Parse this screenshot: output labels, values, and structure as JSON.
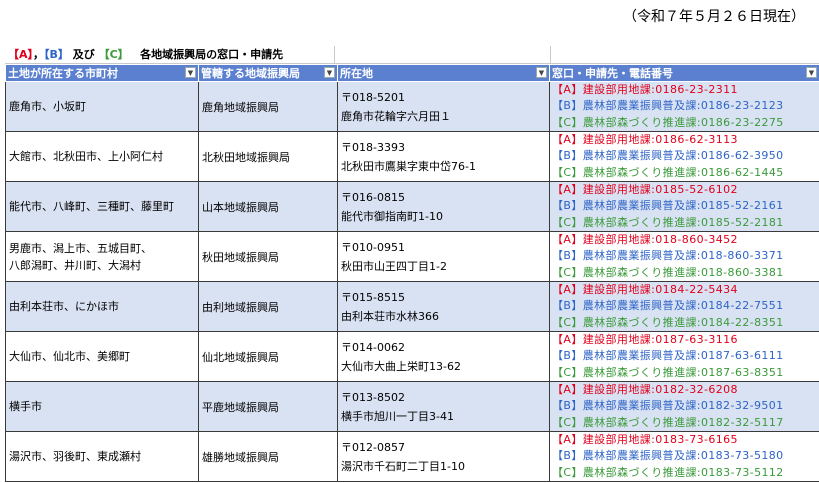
{
  "date_note": "（令和７年５月２６日現在）",
  "legend": {
    "a": "【A】",
    "sep1": "，",
    "b": "【B】",
    "and": " 及び ",
    "c": "【C】",
    "title": "各地域振興局の窓口・申請先"
  },
  "headers": [
    "土地が所在する市町村",
    "管轄する地域振興局",
    "所在地",
    "窓口・申請先・電話番号"
  ],
  "rows": [
    {
      "municipality": [
        "鹿角市、小坂町"
      ],
      "bureau": "鹿角地域振興局",
      "postal": "〒018-5201",
      "address": "鹿角市花輪字六月田１",
      "contacts": [
        "【A】建設部用地課:0186-23-2311",
        "【B】農林部農業振興普及課:0186-23-2123",
        "【C】農林部森づくり推進課:0186-23-2275"
      ]
    },
    {
      "municipality": [
        "大館市、北秋田市、上小阿仁村"
      ],
      "bureau": "北秋田地域振興局",
      "postal": "〒018-3393",
      "address": "北秋田市鷹巣字東中岱76-1",
      "contacts": [
        "【A】建設部用地課:0186-62-3113",
        "【B】農林部農業振興普及課:0186-62-3950",
        "【C】農林部森づくり推進課:0186-62-1445"
      ]
    },
    {
      "municipality": [
        "能代市、八峰町、三種町、藤里町"
      ],
      "bureau": "山本地域振興局",
      "postal": "〒016-0815",
      "address": "能代市御指南町1-10",
      "contacts": [
        "【A】建設部用地課:0185-52-6102",
        "【B】農林部農業振興普及課:0185-52-2161",
        "【C】農林部森づくり推進課:0185-52-2181"
      ]
    },
    {
      "municipality": [
        "男鹿市、潟上市、五城目町、",
        "八郎潟町、井川町、大潟村"
      ],
      "bureau": "秋田地域振興局",
      "postal": "〒010-0951",
      "address": "秋田市山王四丁目1-2",
      "contacts": [
        "【A】建設部用地課:018-860-3452",
        "【B】農林部農業振興普及課:018-860-3371",
        "【C】農林部森づくり推進課:018-860-3381"
      ]
    },
    {
      "municipality": [
        "由利本荘市、にかほ市"
      ],
      "bureau": "由利地域振興局",
      "postal": "〒015-8515",
      "address": "由利本荘市水林366",
      "contacts": [
        "【A】建設部用地課:0184-22-5434",
        "【B】農林部農業振興普及課:0184-22-7551",
        "【C】農林部森づくり推進課:0184-22-8351"
      ]
    },
    {
      "municipality": [
        "大仙市、仙北市、美郷町"
      ],
      "bureau": "仙北地域振興局",
      "postal": "〒014-0062",
      "address": "大仙市大曲上栄町13-62",
      "contacts": [
        "【A】建設部用地課:0187-63-3116",
        "【B】農林部農業振興普及課:0187-63-6111",
        "【C】農林部森づくり推進課:0187-63-8351"
      ]
    },
    {
      "municipality": [
        "横手市"
      ],
      "bureau": "平鹿地域振興局",
      "postal": "〒013-8502",
      "address": "横手市旭川一丁目3-41",
      "contacts": [
        "【A】建設部用地課:0182-32-6208",
        "【B】農林部農業振興普及課:0182-32-9501",
        "【C】農林部森づくり推進課:0182-32-5117"
      ]
    },
    {
      "municipality": [
        "湯沢市、羽後町、東成瀬村"
      ],
      "bureau": "雄勝地域振興局",
      "postal": "〒012-0857",
      "address": "湯沢市千石町二丁目1-10",
      "contacts": [
        "【A】建設部用地課:0183-73-6165",
        "【B】農林部農業振興普及課:0183-73-5180",
        "【C】農林部森づくり推進課:0183-73-5112"
      ]
    }
  ],
  "colors": {
    "header_bg": "#5b80cf",
    "row_alt_bg": "#d9e2f3",
    "a_text": "#e0001b",
    "b_text": "#2e64c8",
    "c_text": "#3a9a3a"
  }
}
